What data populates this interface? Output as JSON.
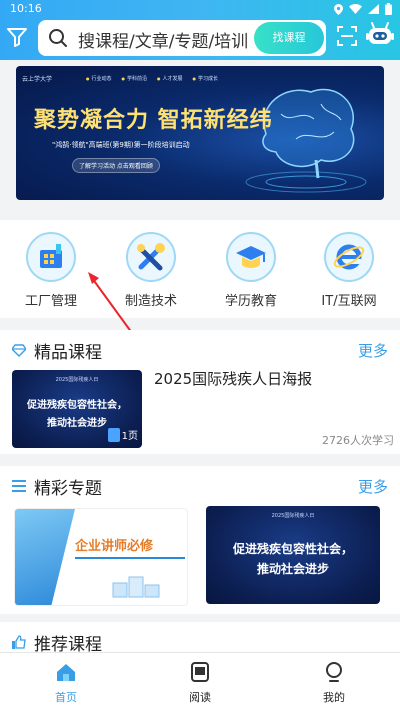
{
  "status_bar": {
    "time": "10:16"
  },
  "header": {
    "search_placeholder": "搜课程/文章/专题/培训",
    "search_button": "找课程"
  },
  "banner": {
    "logo": "云上学大学",
    "nav": [
      "行业动态",
      "学科前沿",
      "人才发展",
      "学习成长"
    ],
    "headline": "聚势凝合力 智拓新经纬",
    "subline": "\"鸿鹄·领航\"高端班(第9期)第一阶段培训启动",
    "pill": "了解学习活动 点击观看回顾"
  },
  "categories": [
    {
      "label": "工厂管理",
      "icon": "factory-icon"
    },
    {
      "label": "制造技术",
      "icon": "tools-icon"
    },
    {
      "label": "学历教育",
      "icon": "graduation-cap-icon"
    },
    {
      "label": "IT/互联网",
      "icon": "internet-explorer-icon"
    }
  ],
  "premium_courses": {
    "title": "精品课程",
    "more": "更多",
    "course": {
      "title": "2025国际残疾人日海报",
      "thumb_top": "2025国际残疾人日",
      "thumb_line1": "促进残疾包容性社会，",
      "thumb_line2": "推动社会进步",
      "pages": "1页",
      "learners": "2726人次学习"
    }
  },
  "special_topics": {
    "title": "精彩专题",
    "more": "更多",
    "card_a": "企业讲师必修",
    "card_b_top": "2025国际残疾人日",
    "card_b_line1": "促进残疾包容性社会，",
    "card_b_line2": "推动社会进步"
  },
  "recommended": {
    "title": "推荐课程"
  },
  "bottom_nav": [
    {
      "label": "首页",
      "active": true,
      "color": "#3a9ee6"
    },
    {
      "label": "阅读",
      "active": false,
      "color": "#333333"
    },
    {
      "label": "我的",
      "active": false,
      "color": "#333333"
    }
  ]
}
